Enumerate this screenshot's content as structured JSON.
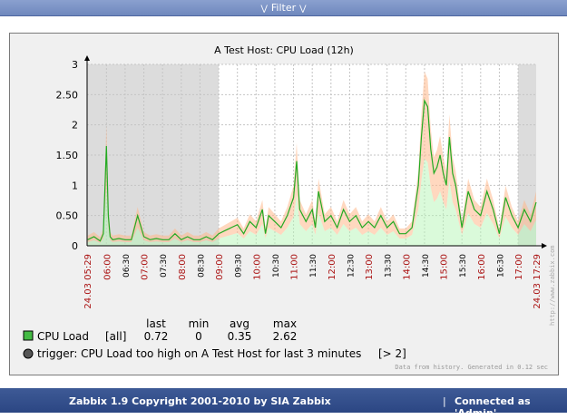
{
  "filter_bar": {
    "label": "Filter",
    "left_icon": "double-chevron-down-icon",
    "right_icon": "double-chevron-down-icon"
  },
  "graph": {
    "title": "A Test Host: CPU Load  (12h)",
    "history_note": "Data from history. Generated in 0.12 sec",
    "watermark": "http://www.zabbix.com",
    "colors": {
      "series": "#22aa22",
      "series_max": "#ffb88a",
      "series_min": "#b5f5b5",
      "shaded": "#dcdcdc",
      "grid": "#c4c4c4",
      "black_tick": "#000000",
      "red_tick": "#aa1111"
    },
    "legend": {
      "headers": [
        "last",
        "min",
        "avg",
        "max"
      ],
      "items": [
        {
          "name": "CPU Load",
          "func": "[all]",
          "last": "0.72",
          "min": "0",
          "avg": "0.35",
          "max": "2.62",
          "color": "#44bb44",
          "icon": "green-square-icon"
        }
      ],
      "trigger": {
        "text": "trigger: CPU Load too high on A Test Host for last 3 minutes",
        "condition": "[> 2]",
        "icon": "trigger-circle-icon"
      }
    }
  },
  "chart_data": {
    "type": "line",
    "title": "A Test Host: CPU Load  (12h)",
    "ylim": [
      0,
      3
    ],
    "y_ticks": [
      "0",
      "0.50",
      "1",
      "1.50",
      "2",
      "2.50",
      "3"
    ],
    "x_ticks": [
      {
        "t": "05:29",
        "label": "24.03 05:29",
        "color": "red"
      },
      {
        "t": "06:00",
        "label": "06:00",
        "color": "red"
      },
      {
        "t": "06:30",
        "label": "06:30",
        "color": "black"
      },
      {
        "t": "07:00",
        "label": "07:00",
        "color": "red"
      },
      {
        "t": "07:30",
        "label": "07:30",
        "color": "black"
      },
      {
        "t": "08:00",
        "label": "08:00",
        "color": "red"
      },
      {
        "t": "08:30",
        "label": "08:30",
        "color": "black"
      },
      {
        "t": "09:00",
        "label": "09:00",
        "color": "red"
      },
      {
        "t": "09:30",
        "label": "09:30",
        "color": "black"
      },
      {
        "t": "10:00",
        "label": "10:00",
        "color": "red"
      },
      {
        "t": "10:30",
        "label": "10:30",
        "color": "black"
      },
      {
        "t": "11:00",
        "label": "11:00",
        "color": "red"
      },
      {
        "t": "11:30",
        "label": "11:30",
        "color": "black"
      },
      {
        "t": "12:00",
        "label": "12:00",
        "color": "red"
      },
      {
        "t": "12:30",
        "label": "12:30",
        "color": "black"
      },
      {
        "t": "13:00",
        "label": "13:00",
        "color": "red"
      },
      {
        "t": "13:30",
        "label": "13:30",
        "color": "black"
      },
      {
        "t": "14:00",
        "label": "14:00",
        "color": "red"
      },
      {
        "t": "14:30",
        "label": "14:30",
        "color": "black"
      },
      {
        "t": "15:00",
        "label": "15:00",
        "color": "red"
      },
      {
        "t": "15:30",
        "label": "15:30",
        "color": "black"
      },
      {
        "t": "16:00",
        "label": "16:00",
        "color": "red"
      },
      {
        "t": "16:30",
        "label": "16:30",
        "color": "black"
      },
      {
        "t": "17:00",
        "label": "17:00",
        "color": "red"
      },
      {
        "t": "17:29",
        "label": "24.03 17:29",
        "color": "red"
      }
    ],
    "shaded_ranges": [
      [
        "05:29",
        "09:00"
      ],
      [
        "17:00",
        "17:29"
      ]
    ],
    "series": [
      {
        "name": "CPU Load",
        "x": [
          "05:30",
          "05:40",
          "05:50",
          "05:55",
          "06:00",
          "06:03",
          "06:06",
          "06:10",
          "06:20",
          "06:30",
          "06:40",
          "06:50",
          "07:00",
          "07:10",
          "07:20",
          "07:30",
          "07:40",
          "07:50",
          "08:00",
          "08:10",
          "08:20",
          "08:30",
          "08:40",
          "08:50",
          "09:00",
          "09:10",
          "09:20",
          "09:30",
          "09:40",
          "09:50",
          "10:00",
          "10:10",
          "10:15",
          "10:20",
          "10:30",
          "10:40",
          "10:50",
          "11:00",
          "11:05",
          "11:10",
          "11:20",
          "11:30",
          "11:35",
          "11:40",
          "11:50",
          "12:00",
          "12:10",
          "12:20",
          "12:30",
          "12:40",
          "12:50",
          "13:00",
          "13:10",
          "13:20",
          "13:30",
          "13:40",
          "13:50",
          "14:00",
          "14:10",
          "14:20",
          "14:25",
          "14:30",
          "14:35",
          "14:40",
          "14:45",
          "14:50",
          "14:55",
          "15:00",
          "15:05",
          "15:10",
          "15:15",
          "15:20",
          "15:30",
          "15:40",
          "15:50",
          "16:00",
          "16:10",
          "16:20",
          "16:30",
          "16:40",
          "16:50",
          "17:00",
          "17:10",
          "17:20",
          "17:29"
        ],
        "values": [
          0.1,
          0.15,
          0.08,
          0.2,
          1.65,
          0.5,
          0.15,
          0.1,
          0.12,
          0.1,
          0.1,
          0.5,
          0.15,
          0.1,
          0.12,
          0.1,
          0.1,
          0.2,
          0.1,
          0.15,
          0.1,
          0.1,
          0.15,
          0.1,
          0.2,
          0.25,
          0.3,
          0.35,
          0.2,
          0.4,
          0.3,
          0.6,
          0.2,
          0.5,
          0.4,
          0.3,
          0.5,
          0.8,
          1.4,
          0.6,
          0.4,
          0.6,
          0.3,
          0.9,
          0.4,
          0.5,
          0.3,
          0.6,
          0.4,
          0.5,
          0.3,
          0.4,
          0.3,
          0.5,
          0.3,
          0.4,
          0.2,
          0.2,
          0.3,
          1.0,
          1.8,
          2.4,
          2.3,
          1.6,
          1.2,
          1.3,
          1.5,
          1.2,
          1.0,
          1.8,
          1.2,
          1.0,
          0.3,
          0.9,
          0.6,
          0.5,
          0.9,
          0.6,
          0.2,
          0.8,
          0.5,
          0.3,
          0.6,
          0.4,
          0.72
        ]
      }
    ],
    "legend_entries": [
      "CPU Load",
      "trigger: CPU Load too high on A Test Host for last 3 minutes"
    ]
  },
  "footer": {
    "copyright": "Zabbix 1.9 Copyright 2001-2010 by SIA Zabbix",
    "separator": "|",
    "connected": "Connected as 'Admin'"
  }
}
